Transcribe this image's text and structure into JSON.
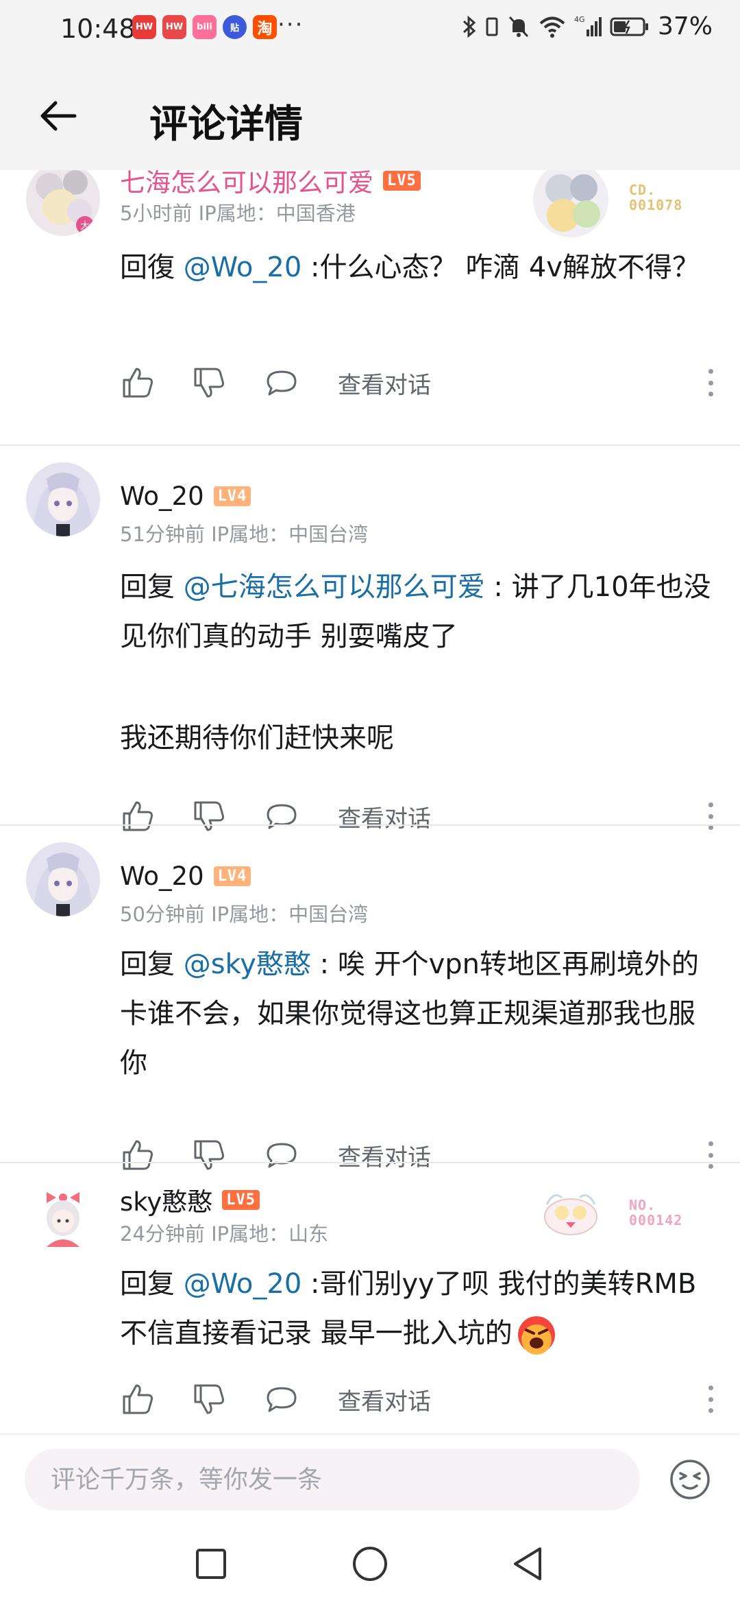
{
  "status_bar": {
    "time": "10:48",
    "apps": [
      {
        "name": "huawei-store-icon",
        "label": "HW",
        "color": "#e93a3a"
      },
      {
        "name": "huawei-mall-icon",
        "label": "HW",
        "color": "#e94848"
      },
      {
        "name": "bilibili-mall-icon",
        "label": "bili",
        "color": "#ff6f9a"
      },
      {
        "name": "tieba-icon",
        "label": "贴",
        "color": "#3b5bdb"
      },
      {
        "name": "taobao-icon",
        "label": "淘",
        "color": "#ff5000"
      }
    ],
    "more": "···",
    "battery_percent": "37%"
  },
  "header": {
    "title": "评论详情"
  },
  "comments": [
    {
      "username": "七海怎么可以那么可爱",
      "level": "LV5",
      "time": "5小时前",
      "ip": "IP属地：中国香港",
      "reply_prefix": "回復 ",
      "mention": "@Wo_20",
      "text": " :什么心态？ 咋滴 4v解放不得？",
      "fan_number": "CD.\n001078",
      "fan_color": "#e3c271",
      "view_thread": "查看对话"
    },
    {
      "username": "Wo_20",
      "level": "LV4",
      "time": "51分钟前",
      "ip": "IP属地：中国台湾",
      "reply_prefix": "回复 ",
      "mention": "@七海怎么可以那么可爱",
      "text": " : 讲了几10年也没见你们真的动手 别耍嘴皮了",
      "text2": "我还期待你们赶快来呢",
      "view_thread": "查看对话"
    },
    {
      "username": "Wo_20",
      "level": "LV4",
      "time": "50分钟前",
      "ip": "IP属地：中国台湾",
      "reply_prefix": "回复 ",
      "mention": "@sky憨憨",
      "text": " : 唉 开个vpn转地区再刷境外的卡谁不会，如果你觉得这也算正规渠道那我也服你",
      "view_thread": "查看对话"
    },
    {
      "username": "sky憨憨",
      "level": "LV5",
      "time": "24分钟前",
      "ip": "IP属地：山东",
      "reply_prefix": "回复 ",
      "mention": "@Wo_20",
      "text": " :哥们别yy了呗 我付的美转RMB 不信直接看记录 最早一批入坑的",
      "fan_number": "NO.\n000142",
      "fan_color": "#f2a5bd",
      "view_thread": "查看对话"
    }
  ],
  "input": {
    "placeholder": "评论千万条，等你发一条"
  },
  "colors": {
    "mention": "#1a6ea6",
    "vip_name": "#e5528c",
    "meta": "#9499a0",
    "lv5": "#ff6f3f",
    "lv4": "#ffb27a"
  }
}
